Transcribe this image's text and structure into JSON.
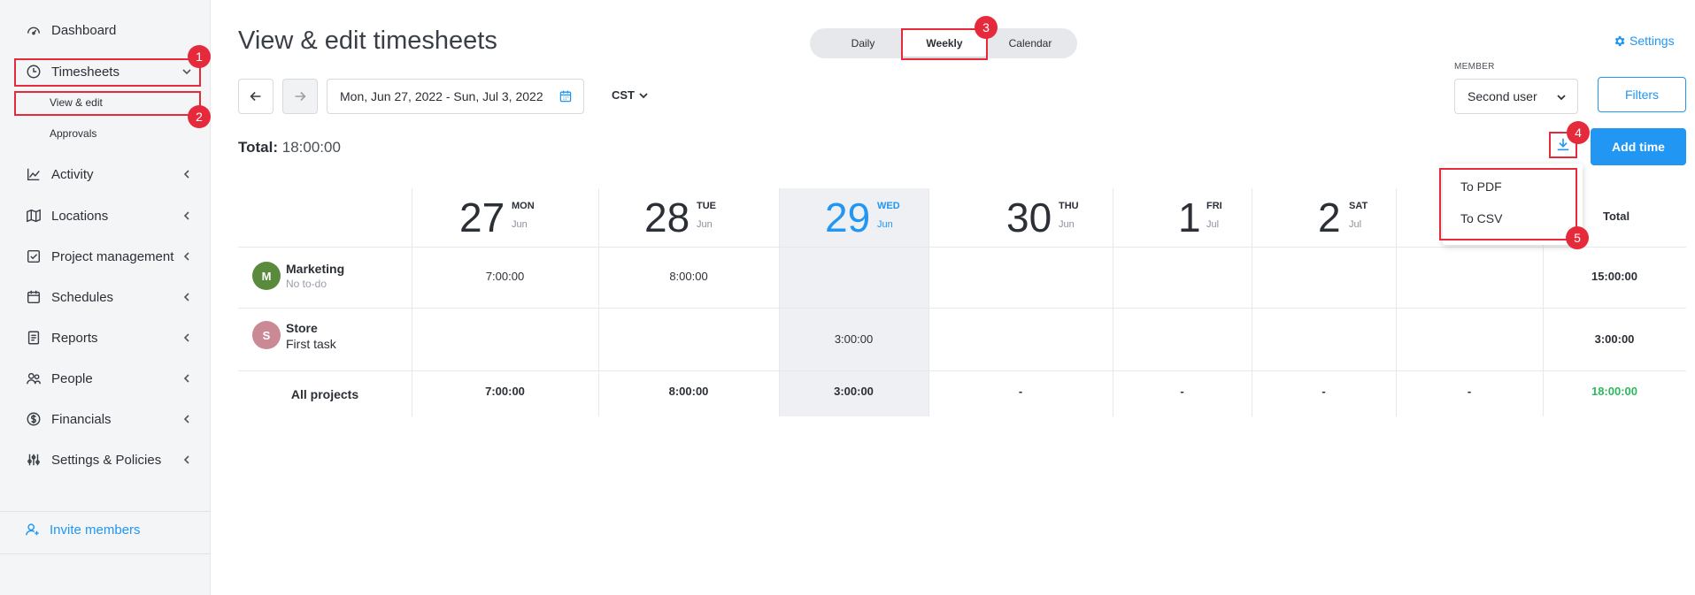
{
  "sidebar": {
    "items": [
      {
        "label": "Dashboard",
        "icon": "dashboard-icon"
      },
      {
        "label": "Timesheets",
        "icon": "clock-icon"
      },
      {
        "label": "Activity",
        "icon": "activity-chart-icon"
      },
      {
        "label": "Locations",
        "icon": "map-icon"
      },
      {
        "label": "Project management",
        "icon": "checkbox-icon"
      },
      {
        "label": "Schedules",
        "icon": "calendar-icon"
      },
      {
        "label": "Reports",
        "icon": "report-icon"
      },
      {
        "label": "People",
        "icon": "people-icon"
      },
      {
        "label": "Financials",
        "icon": "dollar-icon"
      },
      {
        "label": "Settings & Policies",
        "icon": "sliders-icon"
      }
    ],
    "subitems": [
      {
        "label": "View & edit"
      },
      {
        "label": "Approvals"
      }
    ],
    "invite_label": "Invite members"
  },
  "header": {
    "title": "View & edit timesheets",
    "views": [
      "Daily",
      "Weekly",
      "Calendar"
    ],
    "active_view": "Weekly",
    "settings_label": "Settings",
    "date_range": "Mon, Jun 27, 2022 - Sun, Jul 3, 2022",
    "timezone": "CST",
    "member_label": "MEMBER",
    "member_value": "Second user",
    "filters_label": "Filters",
    "total_label": "Total:",
    "total_value": "18:00:00",
    "add_time_label": "Add time"
  },
  "export_menu": {
    "items": [
      "To PDF",
      "To CSV"
    ]
  },
  "annotations": [
    "1",
    "2",
    "3",
    "4",
    "5"
  ],
  "table": {
    "days": [
      {
        "num": "27",
        "name": "MON",
        "month": "Jun"
      },
      {
        "num": "28",
        "name": "TUE",
        "month": "Jun"
      },
      {
        "num": "29",
        "name": "WED",
        "month": "Jun",
        "today": true
      },
      {
        "num": "30",
        "name": "THU",
        "month": "Jun"
      },
      {
        "num": "1",
        "name": "FRI",
        "month": "Jul"
      },
      {
        "num": "2",
        "name": "SAT",
        "month": "Jul"
      }
    ],
    "total_header": "Total",
    "rows": [
      {
        "avatar": "M",
        "avatar_color": "#5a8a3c",
        "name": "Marketing",
        "sub": "No to-do",
        "cells": [
          "7:00:00",
          "8:00:00",
          "",
          "",
          "",
          "",
          ""
        ],
        "total": "15:00:00"
      },
      {
        "avatar": "S",
        "avatar_color": "#c98a96",
        "name": "Store",
        "sub": "First task",
        "cells": [
          "",
          "",
          "3:00:00",
          "",
          "",
          "",
          ""
        ],
        "total": "3:00:00"
      }
    ],
    "all_projects": {
      "label": "All projects",
      "cells": [
        "7:00:00",
        "8:00:00",
        "3:00:00",
        "-",
        "-",
        "-",
        "-"
      ],
      "total": "18:00:00"
    }
  },
  "colors": {
    "accent": "#2196f3",
    "annotation": "#e52b3b",
    "total_green": "#2eb85c"
  }
}
